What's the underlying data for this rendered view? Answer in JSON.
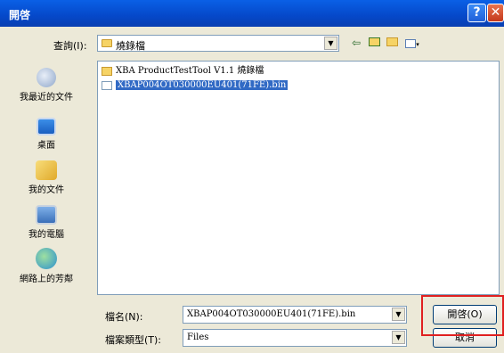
{
  "window": {
    "title": "開啓"
  },
  "titlebar": {
    "help_glyph": "?",
    "close_glyph": "✕"
  },
  "lookin": {
    "label": "查詢(I):",
    "value": "燒錄檔"
  },
  "places": [
    {
      "label": "我最近的文件",
      "icon": "recent-documents-icon"
    },
    {
      "label": "桌面",
      "icon": "desktop-icon"
    },
    {
      "label": "我的文件",
      "icon": "my-documents-icon"
    },
    {
      "label": "我的電腦",
      "icon": "my-computer-icon"
    },
    {
      "label": "網路上的芳鄰",
      "icon": "network-places-icon"
    }
  ],
  "files": [
    {
      "name": "XBA ProductTestTool V1.1 燒錄檔",
      "type": "folder"
    },
    {
      "name": "XBAP004OT030000EU401(71FE).bin",
      "type": "file",
      "selected": true
    }
  ],
  "filename": {
    "label": "檔名(N):",
    "value": "XBAP004OT030000EU401(71FE).bin"
  },
  "filetype": {
    "label": "檔案類型(T):",
    "value": "Files"
  },
  "buttons": {
    "open": "開啓(O)",
    "cancel": "取消"
  },
  "colors": {
    "titlebar": "#0a4fd6",
    "selection": "#316ac5",
    "highlight_box": "#e02020"
  }
}
